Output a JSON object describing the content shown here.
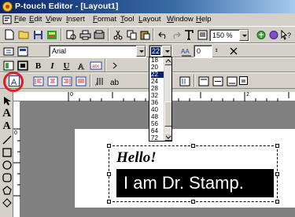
{
  "window": {
    "title": "P-touch Editor - [Layout1]"
  },
  "menu": [
    "File",
    "Edit",
    "View",
    "Insert",
    "Format",
    "Tool",
    "Layout",
    "Window",
    "Help"
  ],
  "toolbar": {
    "zoom": "150 %"
  },
  "format_bar": {
    "font_name": "Arial",
    "font_size": "22",
    "spacing_value": "0",
    "line_value": "0",
    "bold_label": "B",
    "italic_label": "I",
    "underline_label": "U"
  },
  "font_size_list": {
    "options": [
      "18",
      "20",
      "22",
      "24",
      "28",
      "32",
      "36",
      "40",
      "48",
      "56",
      "64",
      "72"
    ],
    "selected": "22"
  },
  "tools": {
    "text_tool_label": "A",
    "text_tool2_label": "A"
  },
  "ruler": {
    "mark_0": "0",
    "mark_1": "1",
    "mark_2": "2"
  },
  "canvas": {
    "line1": "Hello!",
    "line2": "I am Dr. Stamp."
  },
  "colors": {
    "stamp_bg": "#000000",
    "workspace": "#808080",
    "highlight": "#e02020"
  }
}
